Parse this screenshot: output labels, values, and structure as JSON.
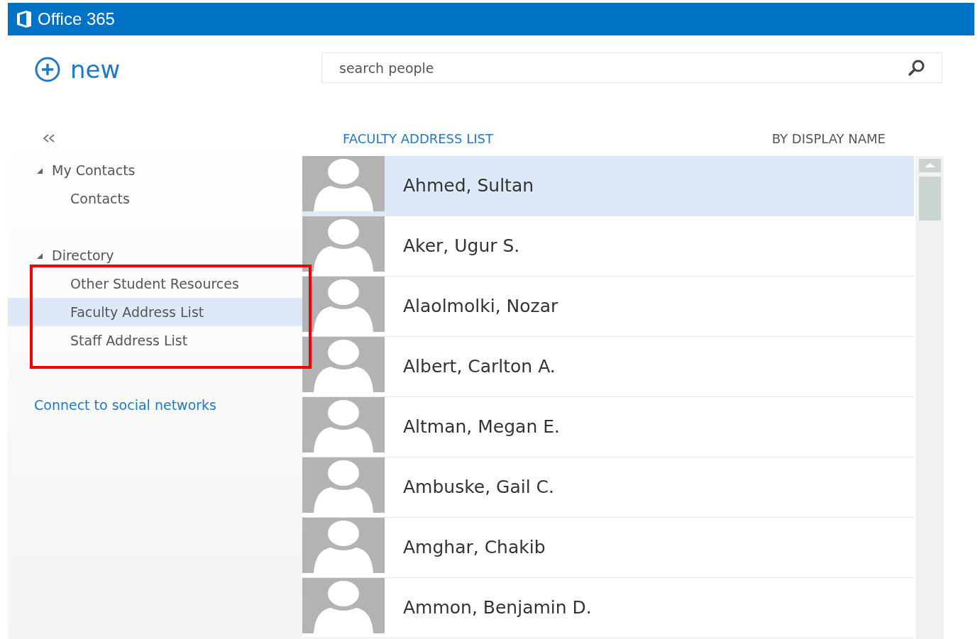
{
  "app": {
    "title": "Office 365"
  },
  "toolbar": {
    "new_label": "new",
    "search": {
      "placeholder": "search people"
    }
  },
  "sidebar": {
    "tree": [
      {
        "label": "My Contacts",
        "expanded": true,
        "annotated": false,
        "children": [
          {
            "label": "Contacts",
            "selected": false
          }
        ]
      },
      {
        "label": "Directory",
        "expanded": true,
        "annotated": true,
        "children": [
          {
            "label": "Other Student Resources",
            "selected": false
          },
          {
            "label": "Faculty Address List",
            "selected": true
          },
          {
            "label": "Staff Address List",
            "selected": false
          }
        ]
      }
    ],
    "social_link": "Connect to social networks"
  },
  "list": {
    "title": "FACULTY ADDRESS LIST",
    "sort": "BY DISPLAY NAME",
    "people": [
      {
        "name": "Ahmed, Sultan",
        "selected": true
      },
      {
        "name": "Aker, Ugur S.",
        "selected": false
      },
      {
        "name": "Alaolmolki, Nozar",
        "selected": false
      },
      {
        "name": "Albert, Carlton A.",
        "selected": false
      },
      {
        "name": "Altman, Megan E.",
        "selected": false
      },
      {
        "name": "Ambuske, Gail C.",
        "selected": false
      },
      {
        "name": "Amghar, Chakib",
        "selected": false
      },
      {
        "name": "Ammon, Benjamin D.",
        "selected": false
      }
    ]
  }
}
